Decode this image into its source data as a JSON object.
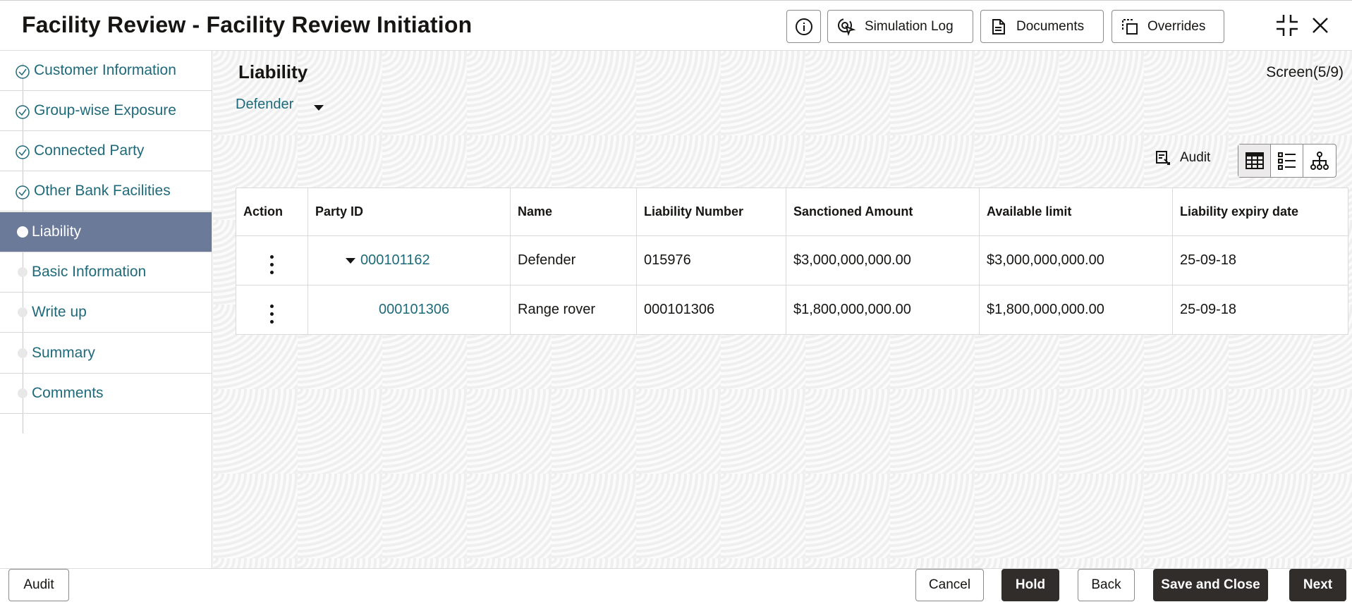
{
  "header": {
    "title": "Facility Review - Facility Review Initiation",
    "buttons": {
      "simulation_log": "Simulation Log",
      "documents": "Documents",
      "overrides": "Overrides"
    },
    "icons": [
      "info-icon",
      "simulation-log-icon",
      "documents-icon",
      "overrides-icon",
      "collapse-icon",
      "close-icon"
    ]
  },
  "sidebar": {
    "items": [
      {
        "label": "Customer Information",
        "state": "completed"
      },
      {
        "label": "Group-wise Exposure",
        "state": "completed"
      },
      {
        "label": "Connected Party",
        "state": "completed"
      },
      {
        "label": "Other Bank Facilities",
        "state": "completed"
      },
      {
        "label": "Liability",
        "state": "active"
      },
      {
        "label": "Basic Information",
        "state": "pending"
      },
      {
        "label": "Write up",
        "state": "pending"
      },
      {
        "label": "Summary",
        "state": "pending"
      },
      {
        "label": "Comments",
        "state": "pending"
      }
    ]
  },
  "main": {
    "section_title": "Liability",
    "screen_count": "Screen(5/9)",
    "party_select": "Defender",
    "audit_label": "Audit",
    "table": {
      "columns": [
        "Action",
        "Party ID",
        "Name",
        "Liability Number",
        "Sanctioned Amount",
        "Available limit",
        "Liability expiry date"
      ],
      "rows": [
        {
          "party_id": "000101162",
          "name": "Defender",
          "liability_number": "015976",
          "sanctioned_amount": "$3,000,000,000.00",
          "available_limit": "$3,000,000,000.00",
          "expiry": "25-09-18"
        },
        {
          "party_id": "000101306",
          "name": "Range rover",
          "liability_number": "000101306",
          "sanctioned_amount": "$1,800,000,000.00",
          "available_limit": "$1,800,000,000.00",
          "expiry": "25-09-18"
        }
      ]
    }
  },
  "footer": {
    "audit": "Audit",
    "cancel": "Cancel",
    "hold": "Hold",
    "back": "Back",
    "save_close": "Save and Close",
    "next": "Next"
  },
  "colors": {
    "link": "#1f6a7a",
    "active_nav": "#6b7a99",
    "dark_button": "#312d2a"
  }
}
